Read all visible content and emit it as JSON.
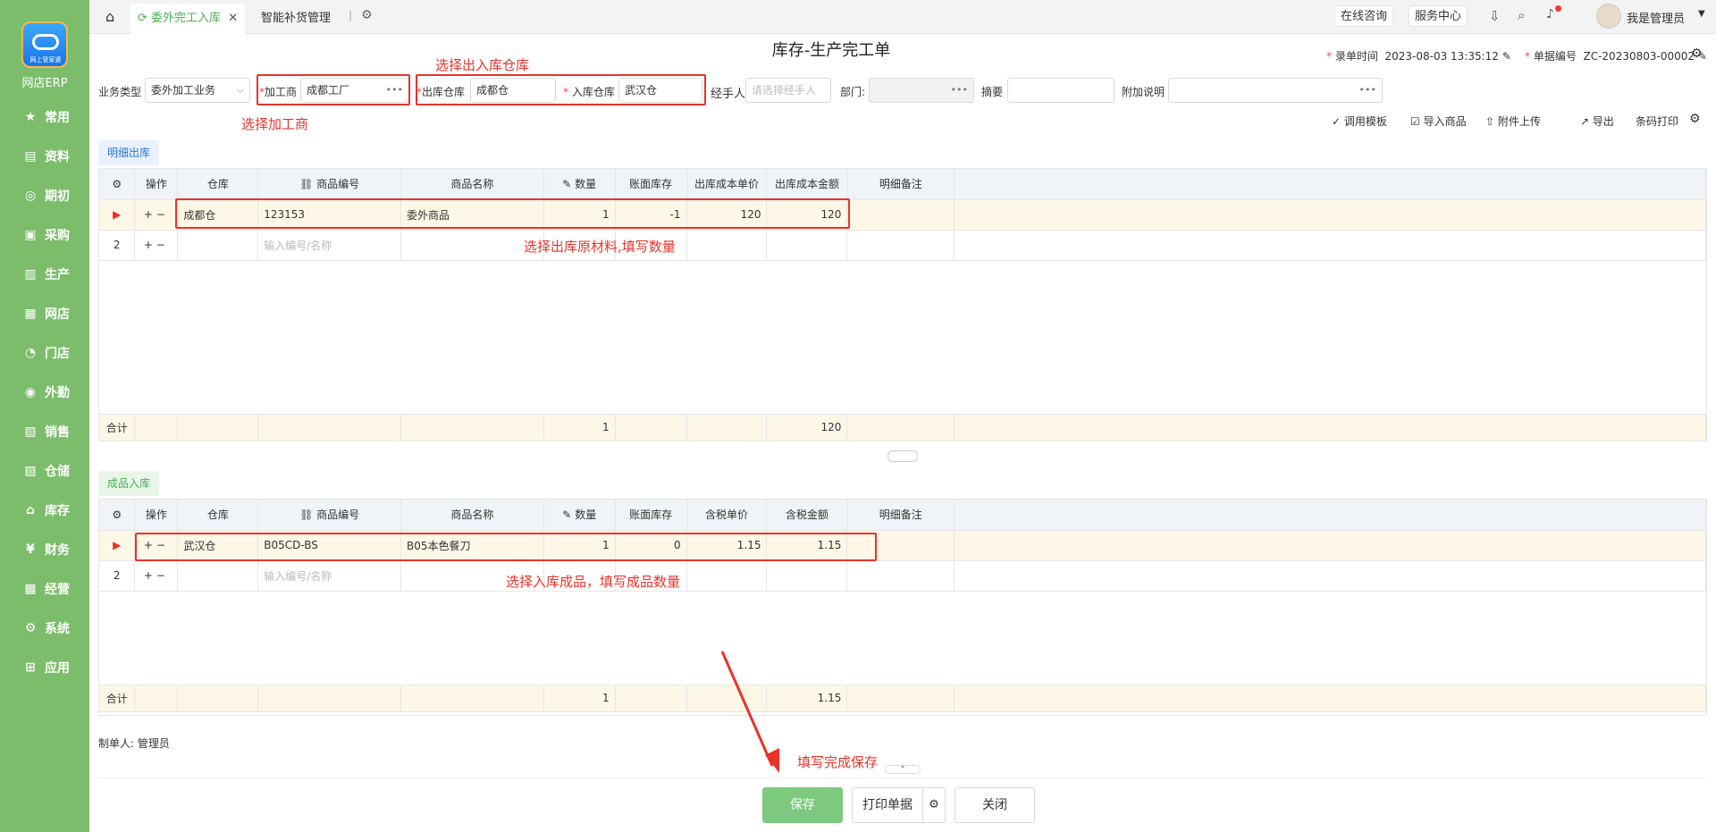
{
  "sidebar": {
    "logo_small": "网上管家婆",
    "logo_text": "网店ERP",
    "items": [
      {
        "label": "常用",
        "icon": "star-icon",
        "glyph": "★"
      },
      {
        "label": "资料",
        "icon": "document-icon",
        "glyph": "▤"
      },
      {
        "label": "期初",
        "icon": "clock-icon",
        "glyph": "◎"
      },
      {
        "label": "采购",
        "icon": "cart-icon",
        "glyph": "▣"
      },
      {
        "label": "生产",
        "icon": "factory-icon",
        "glyph": "▥"
      },
      {
        "label": "网店",
        "icon": "shop-icon",
        "glyph": "▦"
      },
      {
        "label": "门店",
        "icon": "pie-icon",
        "glyph": "◔"
      },
      {
        "label": "外勤",
        "icon": "target-icon",
        "glyph": "◉"
      },
      {
        "label": "销售",
        "icon": "chart-icon",
        "glyph": "▧"
      },
      {
        "label": "仓储",
        "icon": "box-icon",
        "glyph": "▨"
      },
      {
        "label": "库存",
        "icon": "home-icon",
        "glyph": "⌂"
      },
      {
        "label": "财务",
        "icon": "money-icon",
        "glyph": "¥"
      },
      {
        "label": "经营",
        "icon": "monitor-icon",
        "glyph": "▩"
      },
      {
        "label": "系统",
        "icon": "gear-icon",
        "glyph": "⚙"
      },
      {
        "label": "应用",
        "icon": "plus-icon",
        "glyph": "⊞"
      }
    ]
  },
  "topbar": {
    "tab_active": "委外完工入库",
    "tab2": "智能补货管理",
    "online": "在线咨询",
    "service": "服务中心",
    "user": "我是管理员"
  },
  "header": {
    "title": "库存-生产完工单",
    "record_time_label": "录单时间",
    "record_time": "2023-08-03 13:35:12",
    "doc_no_label": "单据编号",
    "doc_no": "ZC-20230803-00002"
  },
  "form": {
    "biz_type_label": "业务类型",
    "biz_type": "委外加工业务",
    "processor_label": "加工商",
    "processor": "成都工厂",
    "out_wh_label": "出库仓库",
    "out_wh": "成都仓",
    "in_wh_label": "入库仓库",
    "in_wh": "武汉仓",
    "handler_label": "经手人",
    "handler_placeholder": "请选择经手人",
    "dept_label": "部门:",
    "summary_label": "摘要",
    "note_label": "附加说明"
  },
  "annotations": {
    "a1": "选择出入库仓库",
    "a2": "选择加工商",
    "a3": "选择出库原材料,填写数量",
    "a4": "选择入库成品，填写成品数量",
    "a5": "填写完成保存"
  },
  "toolbar": {
    "template": "调用模板",
    "import": "导入商品",
    "attach": "附件上传",
    "export": "导出",
    "barcode": "条码打印"
  },
  "section1": {
    "tab": "明细出库",
    "headers": [
      "操作",
      "仓库",
      "商品编号",
      "商品名称",
      "数量",
      "账面库存",
      "出库成本单价",
      "出库成本金额",
      "明细备注"
    ],
    "row1": {
      "wh": "成都仓",
      "code": "123153",
      "name": "委外商品",
      "qty": "1",
      "stock": "-1",
      "price": "120",
      "amount": "120"
    },
    "placeholder": "输入编号/名称",
    "total_label": "合计",
    "total_qty": "1",
    "total_amount": "120"
  },
  "section2": {
    "tab": "成品入库",
    "headers": [
      "操作",
      "仓库",
      "商品编号",
      "商品名称",
      "数量",
      "账面库存",
      "含税单价",
      "含税金额",
      "明细备注"
    ],
    "row1": {
      "wh": "武汉仓",
      "code": "B05CD-BS",
      "name": "B05本色餐刀",
      "qty": "1",
      "stock": "0",
      "price": "1.15",
      "amount": "1.15"
    },
    "placeholder": "输入编号/名称",
    "total_label": "合计",
    "total_qty": "1",
    "total_amount": "1.15"
  },
  "footer": {
    "maker": "制单人: 管理员",
    "save": "保存",
    "print": "打印单据",
    "close": "关闭"
  }
}
